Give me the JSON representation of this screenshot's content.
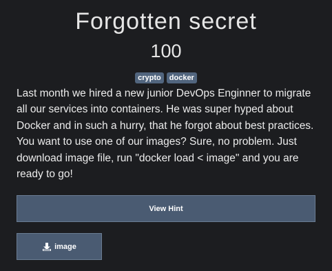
{
  "challenge": {
    "title": "Forgotten secret",
    "points": "100",
    "tags": [
      "crypto",
      "docker"
    ],
    "description": "Last month we hired a new junior DevOps Enginner to migrate all our services into containers. He was super hyped about Docker and in such a hurry, that he forgot about best practices. You want to use one of our images? Sure, no problem. Just download image file, run \"docker load < image\" and you are ready to go!",
    "hint_label": "View Hint",
    "file_label": "image",
    "file_icon": "download-icon"
  },
  "colors": {
    "background": "#1c1d20",
    "tag": "#51657e",
    "button": "#4a5b72",
    "button_border": "#6a7c92",
    "text": "#e8e8e8"
  }
}
